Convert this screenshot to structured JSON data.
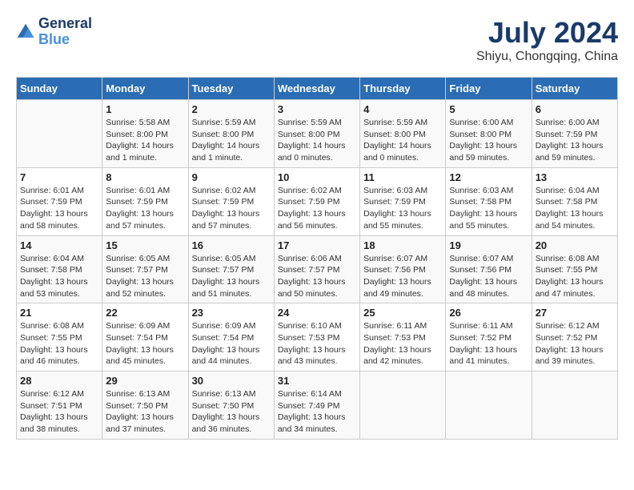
{
  "header": {
    "logo_line1": "General",
    "logo_line2": "Blue",
    "title": "July 2024",
    "subtitle": "Shiyu, Chongqing, China"
  },
  "weekdays": [
    "Sunday",
    "Monday",
    "Tuesday",
    "Wednesday",
    "Thursday",
    "Friday",
    "Saturday"
  ],
  "weeks": [
    [
      {
        "day": "",
        "info": ""
      },
      {
        "day": "1",
        "info": "Sunrise: 5:58 AM\nSunset: 8:00 PM\nDaylight: 14 hours\nand 1 minute."
      },
      {
        "day": "2",
        "info": "Sunrise: 5:59 AM\nSunset: 8:00 PM\nDaylight: 14 hours\nand 1 minute."
      },
      {
        "day": "3",
        "info": "Sunrise: 5:59 AM\nSunset: 8:00 PM\nDaylight: 14 hours\nand 0 minutes."
      },
      {
        "day": "4",
        "info": "Sunrise: 5:59 AM\nSunset: 8:00 PM\nDaylight: 14 hours\nand 0 minutes."
      },
      {
        "day": "5",
        "info": "Sunrise: 6:00 AM\nSunset: 8:00 PM\nDaylight: 13 hours\nand 59 minutes."
      },
      {
        "day": "6",
        "info": "Sunrise: 6:00 AM\nSunset: 7:59 PM\nDaylight: 13 hours\nand 59 minutes."
      }
    ],
    [
      {
        "day": "7",
        "info": "Sunrise: 6:01 AM\nSunset: 7:59 PM\nDaylight: 13 hours\nand 58 minutes."
      },
      {
        "day": "8",
        "info": "Sunrise: 6:01 AM\nSunset: 7:59 PM\nDaylight: 13 hours\nand 57 minutes."
      },
      {
        "day": "9",
        "info": "Sunrise: 6:02 AM\nSunset: 7:59 PM\nDaylight: 13 hours\nand 57 minutes."
      },
      {
        "day": "10",
        "info": "Sunrise: 6:02 AM\nSunset: 7:59 PM\nDaylight: 13 hours\nand 56 minutes."
      },
      {
        "day": "11",
        "info": "Sunrise: 6:03 AM\nSunset: 7:59 PM\nDaylight: 13 hours\nand 55 minutes."
      },
      {
        "day": "12",
        "info": "Sunrise: 6:03 AM\nSunset: 7:58 PM\nDaylight: 13 hours\nand 55 minutes."
      },
      {
        "day": "13",
        "info": "Sunrise: 6:04 AM\nSunset: 7:58 PM\nDaylight: 13 hours\nand 54 minutes."
      }
    ],
    [
      {
        "day": "14",
        "info": "Sunrise: 6:04 AM\nSunset: 7:58 PM\nDaylight: 13 hours\nand 53 minutes."
      },
      {
        "day": "15",
        "info": "Sunrise: 6:05 AM\nSunset: 7:57 PM\nDaylight: 13 hours\nand 52 minutes."
      },
      {
        "day": "16",
        "info": "Sunrise: 6:05 AM\nSunset: 7:57 PM\nDaylight: 13 hours\nand 51 minutes."
      },
      {
        "day": "17",
        "info": "Sunrise: 6:06 AM\nSunset: 7:57 PM\nDaylight: 13 hours\nand 50 minutes."
      },
      {
        "day": "18",
        "info": "Sunrise: 6:07 AM\nSunset: 7:56 PM\nDaylight: 13 hours\nand 49 minutes."
      },
      {
        "day": "19",
        "info": "Sunrise: 6:07 AM\nSunset: 7:56 PM\nDaylight: 13 hours\nand 48 minutes."
      },
      {
        "day": "20",
        "info": "Sunrise: 6:08 AM\nSunset: 7:55 PM\nDaylight: 13 hours\nand 47 minutes."
      }
    ],
    [
      {
        "day": "21",
        "info": "Sunrise: 6:08 AM\nSunset: 7:55 PM\nDaylight: 13 hours\nand 46 minutes."
      },
      {
        "day": "22",
        "info": "Sunrise: 6:09 AM\nSunset: 7:54 PM\nDaylight: 13 hours\nand 45 minutes."
      },
      {
        "day": "23",
        "info": "Sunrise: 6:09 AM\nSunset: 7:54 PM\nDaylight: 13 hours\nand 44 minutes."
      },
      {
        "day": "24",
        "info": "Sunrise: 6:10 AM\nSunset: 7:53 PM\nDaylight: 13 hours\nand 43 minutes."
      },
      {
        "day": "25",
        "info": "Sunrise: 6:11 AM\nSunset: 7:53 PM\nDaylight: 13 hours\nand 42 minutes."
      },
      {
        "day": "26",
        "info": "Sunrise: 6:11 AM\nSunset: 7:52 PM\nDaylight: 13 hours\nand 41 minutes."
      },
      {
        "day": "27",
        "info": "Sunrise: 6:12 AM\nSunset: 7:52 PM\nDaylight: 13 hours\nand 39 minutes."
      }
    ],
    [
      {
        "day": "28",
        "info": "Sunrise: 6:12 AM\nSunset: 7:51 PM\nDaylight: 13 hours\nand 38 minutes."
      },
      {
        "day": "29",
        "info": "Sunrise: 6:13 AM\nSunset: 7:50 PM\nDaylight: 13 hours\nand 37 minutes."
      },
      {
        "day": "30",
        "info": "Sunrise: 6:13 AM\nSunset: 7:50 PM\nDaylight: 13 hours\nand 36 minutes."
      },
      {
        "day": "31",
        "info": "Sunrise: 6:14 AM\nSunset: 7:49 PM\nDaylight: 13 hours\nand 34 minutes."
      },
      {
        "day": "",
        "info": ""
      },
      {
        "day": "",
        "info": ""
      },
      {
        "day": "",
        "info": ""
      }
    ]
  ]
}
